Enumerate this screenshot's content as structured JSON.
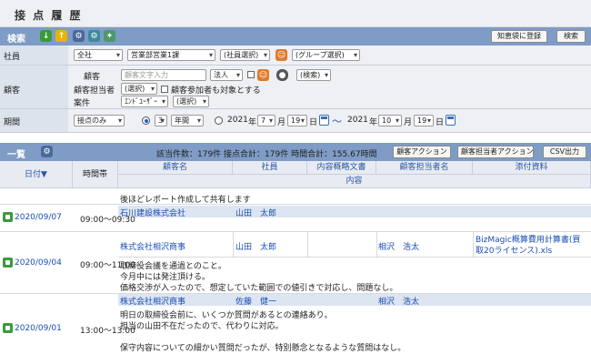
{
  "page": {
    "title": "接 点 履 歴"
  },
  "search": {
    "label": "検索",
    "save_btn": "知恵袋に登録",
    "search_btn": "検索",
    "staff": {
      "label": "社員",
      "scope": "全社",
      "dept": "営業部営業1課",
      "employee": "(社員選択)",
      "group": "(グループ選択)"
    },
    "customer": {
      "label": "顧客",
      "field_label": "顧客",
      "placeholder": "顧客文字入力",
      "type": "法人",
      "search_sel": "(検索)",
      "owner_label": "顧客担当者",
      "owner_sel": "(選択)",
      "include_participant": "顧客参加者も対象とする",
      "case_label": "案件",
      "case_user": "ｴﾝﾄﾞﾕｰｻﾞｰ",
      "case_sel": "(選択)"
    },
    "period": {
      "label": "期間",
      "mode": "接点のみ",
      "num": "3",
      "unit": "年間",
      "from_year": "2021",
      "from_month": "7",
      "from_day": "19",
      "to_year": "2021",
      "to_month": "10",
      "to_day": "19",
      "year_label": "年",
      "month_label": "月",
      "day_label": "日",
      "tilde": "〜"
    }
  },
  "list": {
    "label": "一覧",
    "summary": "該当件数：179件 接点合計：179件 時間合計：155.67時間",
    "btn_customer": "顧客アクション",
    "btn_owner": "顧客担当者アクション",
    "btn_csv": "CSV出力"
  },
  "table": {
    "headers": {
      "date": "日付▼",
      "time": "時間帯",
      "customer": "顧客名",
      "employee": "社員",
      "doc": "内容概略文書",
      "owner": "顧客担当者名",
      "attach": "添付資料",
      "content": "内容"
    },
    "prev_text": "後ほどレポート作成して共有します",
    "records": [
      {
        "date": "2020/09/07",
        "time": "09:00～09:30",
        "customer": "石川建設株式会社",
        "employee": "山田　太郎",
        "owner": "",
        "attach": "",
        "lines": []
      },
      {
        "date": "2020/09/04",
        "time": "09:00～11:00",
        "customer": "株式会社相沢商事",
        "employee": "山田　太郎",
        "owner": "相沢　浩太",
        "attach": "BizMagic概算費用計算書(買取20ライセンス).xls",
        "attach_line1": "BizMagic概算費用計算書(買",
        "attach_line2": "取20ライセンス).xls",
        "lines": [
          "取締役会議を通過とのこと。",
          "今月中には発注頂ける。",
          "価格交渉が入ったので、想定していた範囲での値引きで対応し、問題なし。"
        ]
      },
      {
        "date": "2020/09/01",
        "time": "13:00～13:00",
        "customer": "株式会社相沢商事",
        "employee": "佐藤　健一",
        "owner": "相沢　浩太",
        "attach": "",
        "lines": [
          "明日の取締役会前に、いくつか質問があるとの連絡あり。",
          "担当の山田不在だったので、代わりに対応。",
          "",
          "保守内容についての細かい質問だったが、特別懸念となるような質問はなし。"
        ]
      }
    ]
  },
  "icons": {
    "down": "arrow-down-icon",
    "up": "arrow-up-icon",
    "gear": "gear-icon",
    "person": "person-icon",
    "binoculars": "binoculars-icon",
    "calendar": "calendar-icon"
  },
  "colors": {
    "accent_bar": "#7f9cc6",
    "link": "#1a4fb0",
    "title_bg": "#eef0f4"
  }
}
